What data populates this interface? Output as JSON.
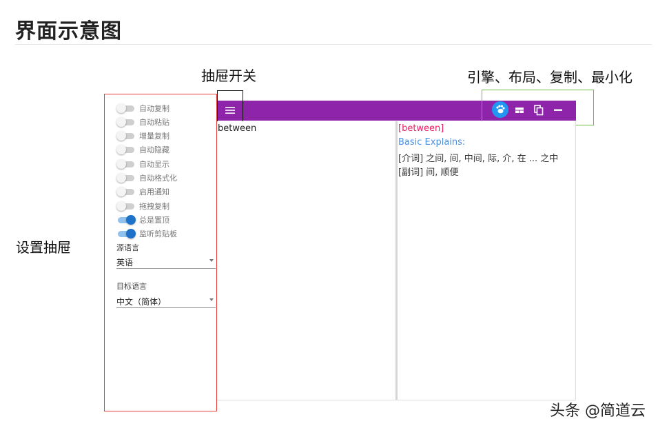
{
  "page_title": "界面示意图",
  "callouts": {
    "drawer_toggle": "抽屉开关",
    "toolbar": "引擎、布局、复制、最小化",
    "settings_drawer": "设置抽屉"
  },
  "settings": {
    "toggles": [
      {
        "label": "自动复制",
        "on": false
      },
      {
        "label": "自动粘贴",
        "on": false
      },
      {
        "label": "增量复制",
        "on": false
      },
      {
        "label": "自动隐藏",
        "on": false
      },
      {
        "label": "自动显示",
        "on": false
      },
      {
        "label": "自动格式化",
        "on": false
      },
      {
        "label": "启用通知",
        "on": false
      },
      {
        "label": "拖拽复制",
        "on": false
      },
      {
        "label": "总是置顶",
        "on": true
      },
      {
        "label": "监听剪贴板",
        "on": true
      }
    ],
    "source_lang_label": "源语言",
    "source_lang_value": "英语",
    "target_lang_label": "目标语言",
    "target_lang_value": "中文（简体）"
  },
  "toolbar": {
    "icons": [
      "menu-icon",
      "engine-icon",
      "layout-icon",
      "copy-icon",
      "minimize-icon"
    ],
    "bar_color": "#8e24aa",
    "engine_color": "#2196f3"
  },
  "source": {
    "text": "between"
  },
  "result": {
    "word": "[between]",
    "explain_label": "Basic Explains:",
    "line1": "[介词] 之间, 间, 中间, 际, 介, 在 ... 之中",
    "line2": "[副词] 间, 顺便"
  },
  "watermark": "头条 @简道云"
}
